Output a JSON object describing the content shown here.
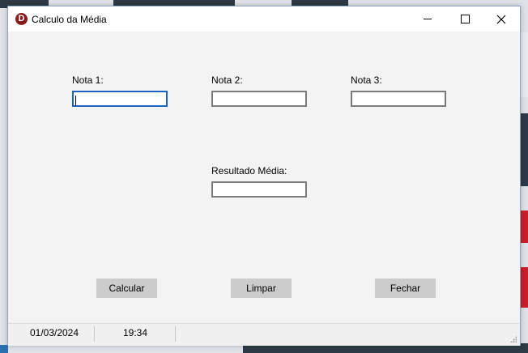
{
  "window": {
    "title": "Calculo da Média",
    "icon": "delphi-app-icon",
    "controls": [
      "minimize-icon",
      "maximize-icon",
      "close-icon"
    ]
  },
  "fields": {
    "nota1": {
      "label": "Nota 1:",
      "value": ""
    },
    "nota2": {
      "label": "Nota 2:",
      "value": ""
    },
    "nota3": {
      "label": "Nota 3:",
      "value": ""
    },
    "resultado": {
      "label": "Resultado Média:",
      "value": ""
    }
  },
  "buttons": {
    "calcular": "Calcular",
    "limpar": "Limpar",
    "fechar": "Fechar"
  },
  "statusbar": {
    "date": "01/03/2024",
    "time": "19:34"
  },
  "colors": {
    "focus_border": "#1c64c8",
    "button_bg": "#cccccc",
    "form_bg": "#f3f3f3"
  }
}
